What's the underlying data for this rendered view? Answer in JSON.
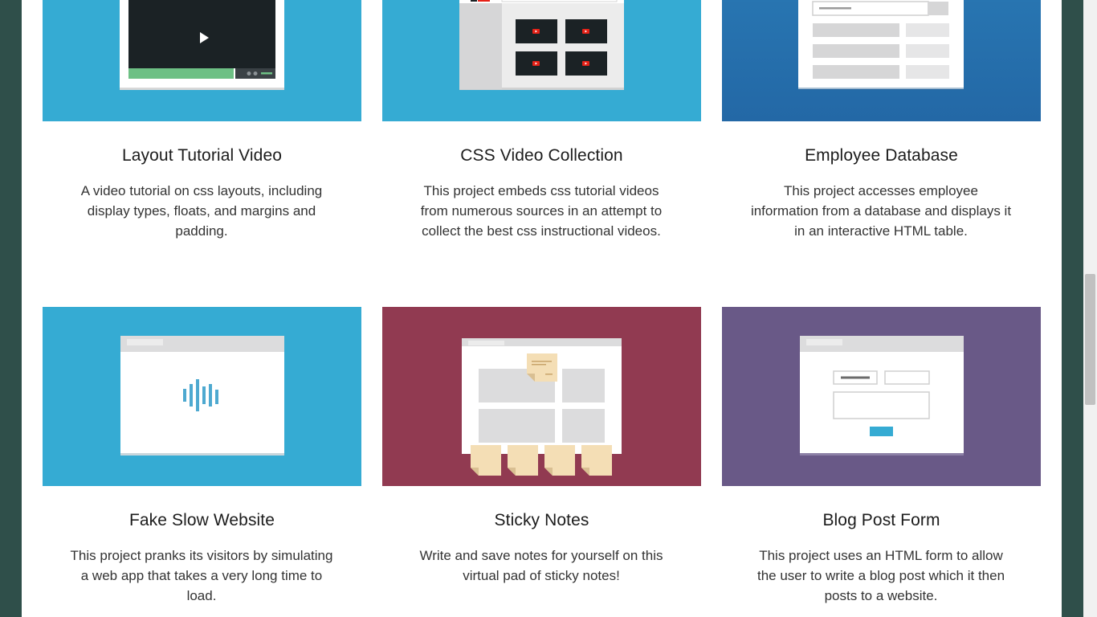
{
  "colors": {
    "cyan": "#35abd3",
    "blue": "#2673ad",
    "maroon": "#913a51",
    "purple": "#695987",
    "window": "#ffffff",
    "gray_block": "#dcdcdd",
    "sticky": "#f4deb5",
    "video_green": "#6dc084",
    "video_dark": "#1b2225",
    "youtube_red": "#e62117",
    "sky_button": "#35abd3"
  },
  "projects": [
    {
      "title": "Layout Tutorial Video",
      "description": "A video tutorial on css layouts, including display types, floats, and margins and padding.",
      "thumbnail": "video-player-thumbnail"
    },
    {
      "title": "CSS Video Collection",
      "description": "This project embeds css tutorial videos from numerous sources in an attempt to collect the best css instructional videos.",
      "thumbnail": "video-grid-thumbnail"
    },
    {
      "title": "Employee Database",
      "description": "This project accesses employee information from a database and displays it in an interactive HTML table.",
      "thumbnail": "table-thumbnail"
    },
    {
      "title": "Fake Slow Website",
      "description": "This project pranks its visitors by simulating a web app that takes a very long time to load.",
      "thumbnail": "loading-thumbnail"
    },
    {
      "title": "Sticky Notes",
      "description": "Write and save notes for yourself on this virtual pad of sticky notes!",
      "thumbnail": "sticky-notes-thumbnail"
    },
    {
      "title": "Blog Post Form",
      "description": "This project uses an HTML form to allow the user to write a blog post which it then posts to a website.",
      "thumbnail": "form-thumbnail"
    }
  ]
}
